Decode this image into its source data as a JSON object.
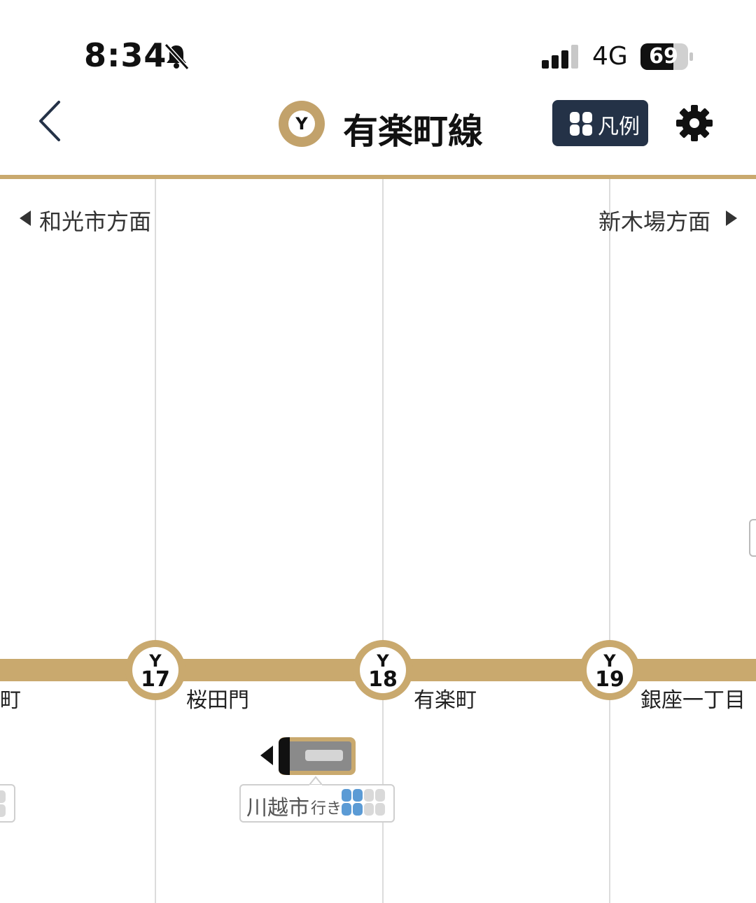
{
  "status_bar": {
    "time": "8:34",
    "network": "4G",
    "battery": "69"
  },
  "header": {
    "line_code": "Y",
    "line_name": "有楽町線",
    "legend_label": "凡例"
  },
  "directions": {
    "left": "和光市方面",
    "right": "新木場方面"
  },
  "stations": [
    {
      "letter": "Y",
      "number": "17",
      "name": "桜田門"
    },
    {
      "letter": "Y",
      "number": "18",
      "name": "有楽町"
    },
    {
      "letter": "Y",
      "number": "19",
      "name": "銀座一丁目"
    }
  ],
  "partial_station_name": "町",
  "train": {
    "destination": "川越市",
    "destination_suffix": "行き"
  },
  "colors": {
    "line": "#c9a96e",
    "legend_bg": "#243247",
    "car_blue": "#5b9bd5",
    "car_gray": "#d9d9d9"
  }
}
